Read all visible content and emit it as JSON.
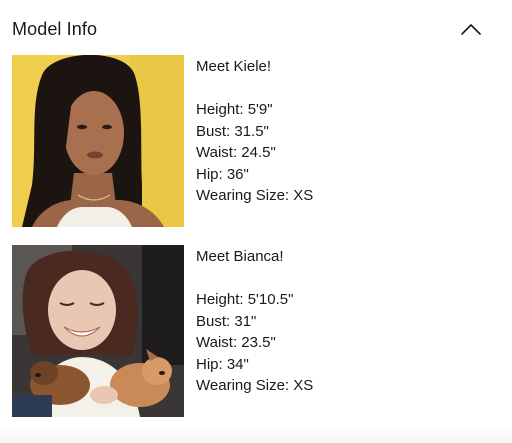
{
  "header": {
    "title": "Model Info",
    "toggle_icon": "chevron-up-icon"
  },
  "models": [
    {
      "intro": "Meet Kiele!",
      "height": "Height: 5'9\"",
      "bust": "Bust: 31.5\"",
      "waist": "Waist: 24.5\"",
      "hip": "Hip: 36\"",
      "wearing_size": "Wearing Size: XS",
      "photo_background": "#f0cf4e"
    },
    {
      "intro": "Meet Bianca!",
      "height": "Height: 5'10.5\"",
      "bust": "Bust: 31\"",
      "waist": "Waist: 23.5\"",
      "hip": "Hip: 34\"",
      "wearing_size": "Wearing Size: XS",
      "photo_background": "#3a3636"
    }
  ]
}
